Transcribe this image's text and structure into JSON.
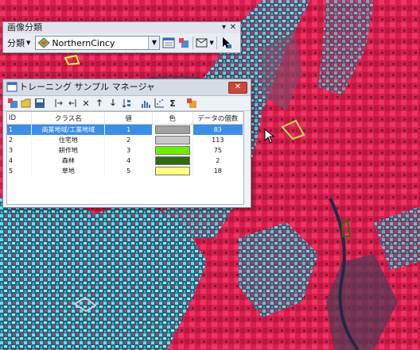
{
  "toolbar": {
    "title": "画像分類",
    "menu_label": "分類",
    "layer_value": "NorthernCincy",
    "pin_glyph": "▾",
    "close_glyph": "✕"
  },
  "manager": {
    "title": "トレーニング サンプル マネージャ",
    "close_glyph": "✕",
    "columns": [
      "ID",
      "クラス名",
      "値",
      "色",
      "データの個数"
    ],
    "rows": [
      {
        "id": "1",
        "name": "商業地域/工業地域",
        "value": "1",
        "color": "#a0a0a0",
        "count": "83"
      },
      {
        "id": "2",
        "name": "住宅地",
        "value": "2",
        "color": "#c8c8c8",
        "count": "113"
      },
      {
        "id": "3",
        "name": "耕作地",
        "value": "3",
        "color": "#6cf000",
        "count": "75"
      },
      {
        "id": "4",
        "name": "森林",
        "value": "4",
        "color": "#2f6a10",
        "count": "2"
      },
      {
        "id": "5",
        "name": "草地",
        "value": "5",
        "color": "#ffff80",
        "count": "18"
      }
    ]
  },
  "colors": {
    "map_vegetation": "#e0204f",
    "map_urban": "#3fd3d8",
    "selection_blue": "#3a8ee6"
  }
}
